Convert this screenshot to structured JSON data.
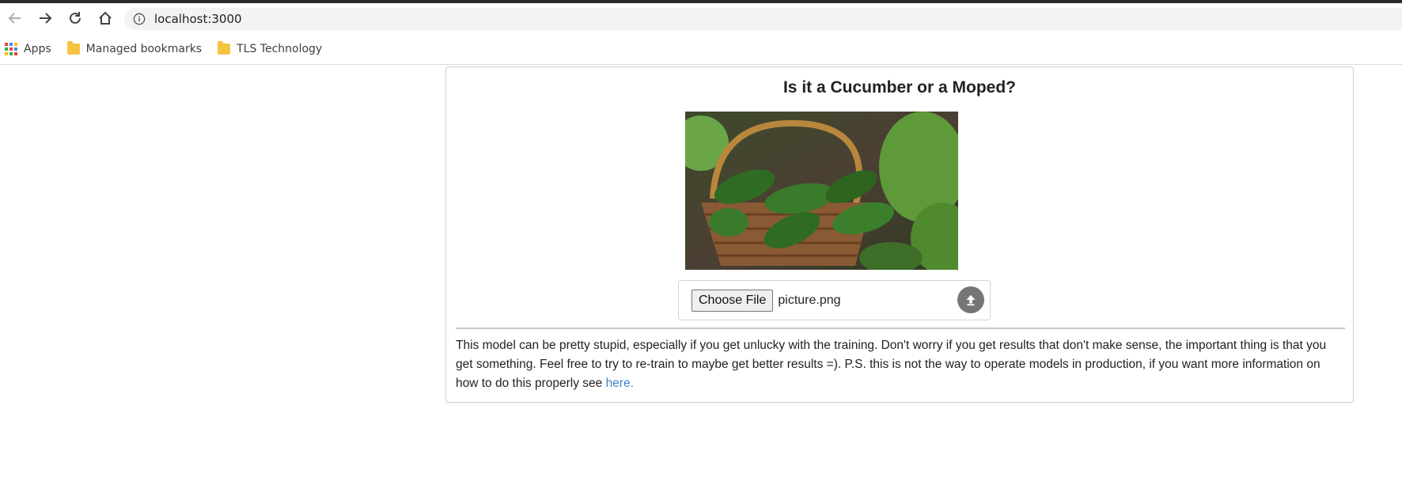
{
  "browser": {
    "url": "localhost:3000",
    "bookmarks": [
      {
        "label": "Apps",
        "icon": "apps-grid-icon"
      },
      {
        "label": "Managed bookmarks",
        "icon": "managed-folder-icon"
      },
      {
        "label": "TLS Technology",
        "icon": "folder-icon"
      }
    ]
  },
  "page": {
    "title": "Is it a Cucumber or a Moped?",
    "image_alt": "cucumbers-in-basket",
    "uploader": {
      "button_label": "Choose File",
      "file_name": "picture.png",
      "upload_icon": "upload-icon"
    },
    "description": "This model can be pretty stupid, especially if you get unlucky with the training. Don't worry if you get results that don't make sense, the important thing is that you get something. Feel free to try to re-train to maybe get better results =). P.S. this is not the way to operate models in production, if you want more information on how to do this properly see ",
    "link_text": "here."
  },
  "colors": {
    "link": "#4183c4",
    "border": "#d4d4d5",
    "upload_icon_bg": "#767676"
  }
}
